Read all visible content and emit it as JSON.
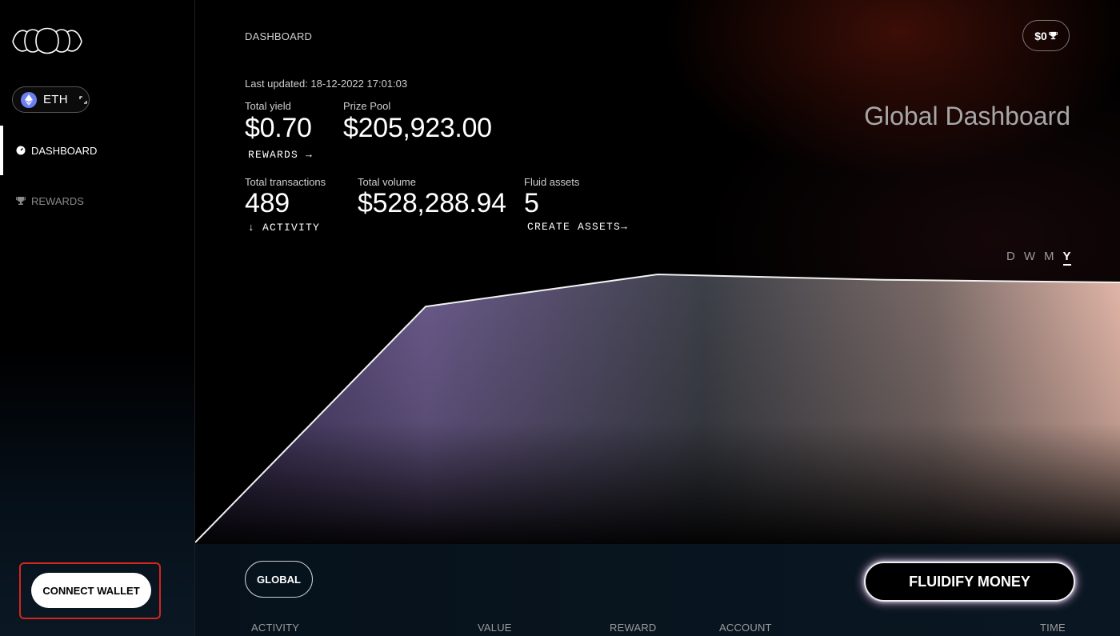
{
  "sidebar": {
    "chain": {
      "label": "ETH",
      "icon": "ethereum-icon",
      "switch_icon": "switch-icon"
    },
    "nav": [
      {
        "label": "DASHBOARD",
        "icon": "dashboard-gauge-icon",
        "active": true
      },
      {
        "label": "REWARDS",
        "icon": "trophy-icon",
        "active": false
      }
    ],
    "connect_wallet_label": "CONNECT WALLET"
  },
  "header": {
    "breadcrumb": "DASHBOARD",
    "reward_pill": {
      "label": "$0",
      "icon": "trophy-icon"
    }
  },
  "stats": {
    "last_updated": "Last updated: 18-12-2022 17:01:03",
    "total_yield": {
      "label": "Total yield",
      "value": "$0.70",
      "link": "REWARDS →"
    },
    "prize_pool": {
      "label": "Prize Pool",
      "value": "$205,923.00"
    },
    "total_transactions": {
      "label": "Total transactions",
      "value": "489",
      "link": "↓ ACTIVITY"
    },
    "total_volume": {
      "label": "Total volume",
      "value": "$528,288.94"
    },
    "fluid_assets": {
      "label": "Fluid assets",
      "value": "5",
      "link": "CREATE ASSETS→"
    }
  },
  "main": {
    "title": "Global Dashboard",
    "periods": [
      "D",
      "W",
      "M",
      "Y"
    ],
    "selected_period": "Y",
    "global_button": "GLOBAL",
    "fluidify_button": "FLUIDIFY MONEY",
    "table_columns": [
      "ACTIVITY",
      "VALUE",
      "REWARD",
      "ACCOUNT",
      "TIME"
    ]
  },
  "colors": {
    "accent_connect_outline": "#d3261d",
    "eth": "#6a7ff0"
  },
  "chart_data": {
    "type": "area",
    "x": [
      0,
      1,
      2,
      3,
      4
    ],
    "values": [
      0,
      0.88,
      1,
      0.98,
      0.97
    ],
    "grid": false,
    "legend": "none"
  }
}
